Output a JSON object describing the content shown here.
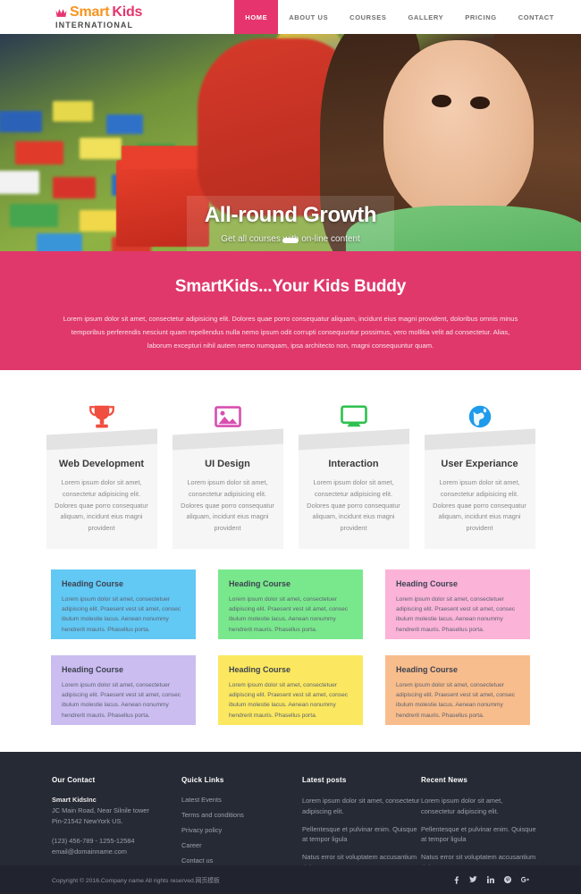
{
  "header": {
    "logo": {
      "icon": "crown-icon",
      "word1": "Smart",
      "word2": "Kids",
      "subtitle": "INTERNATIONAL",
      "color1": "#f7941e",
      "color2": "#e6356e"
    },
    "nav": [
      {
        "label": "HOME",
        "active": true
      },
      {
        "label": "ABOUT US",
        "active": false
      },
      {
        "label": "COURSES",
        "active": false
      },
      {
        "label": "GALLERY",
        "active": false
      },
      {
        "label": "PRICING",
        "active": false
      },
      {
        "label": "CONTACT",
        "active": false
      }
    ]
  },
  "hero": {
    "title": "All-round Growth",
    "subtitle": "Get all courses with on-line content",
    "slider_indicator": "slide-1-active"
  },
  "banner": {
    "title": "SmartKids...Your Kids Buddy",
    "text": "Lorem ipsum dolor sit amet, consectetur adipisicing elit. Dolores quae porro consequatur aliquam, incidunt eius magni provident, doloribus omnis minus temporibus perferendis nesciunt quam repellendus nulla nemo ipsum odit corrupti consequuntur possimus, vero mollitia velit ad consectetur. Alias, laborum excepturi nihil autem nemo numquam, ipsa architecto non, magni consequuntur quam.",
    "bg_color": "#e0386b"
  },
  "services": [
    {
      "icon": "trophy-icon",
      "icon_color": "#f04e3e",
      "title": "Web Development",
      "text": "Lorem ipsum dolor sit amet, consectetur adipisicing elit. Dolores quae porro consequatur aliquam, incidunt eius magni provident"
    },
    {
      "icon": "image-icon",
      "icon_color": "#d84fb0",
      "title": "UI Design",
      "text": "Lorem ipsum dolor sit amet, consectetur adipisicing elit. Dolores quae porro consequatur aliquam, incidunt eius magni provident"
    },
    {
      "icon": "monitor-icon",
      "icon_color": "#2fc14f",
      "title": "Interaction",
      "text": "Lorem ipsum dolor sit amet, consectetur adipisicing elit. Dolores quae porro consequatur aliquam, incidunt eius magni provident"
    },
    {
      "icon": "globe-icon",
      "icon_color": "#1e9bea",
      "title": "User Experiance",
      "text": "Lorem ipsum dolor sit amet, consectetur adipisicing elit. Dolores quae porro consequatur aliquam, incidunt eius magni provident"
    }
  ],
  "courses": [
    {
      "title": "Heading Course",
      "text": "Lorem ipsum dolor sit amet, consectetuer adipiscing elit. Praesent vest sit amet, consec ibulum molestie lacus. Aenean nonummy hendrerit mauris. Phasellus porta.",
      "color": "#62c8f4"
    },
    {
      "title": "Heading Course",
      "text": "Lorem ipsum dolor sit amet, consectetuer adipiscing elit. Praesent vest sit amet, consec ibulum molestie lacus. Aenean nonummy hendrerit mauris. Phasellus porta.",
      "color": "#79e88c"
    },
    {
      "title": "Heading Course",
      "text": "Lorem ipsum dolor sit amet, consectetuer adipiscing elit. Praesent vest sit amet, consec ibulum molestie lacus. Aenean nonummy hendrerit mauris. Phasellus porta.",
      "color": "#fbb3d8"
    },
    {
      "title": "Heading Course",
      "text": "Lorem ipsum dolor sit amet, consectetuer adipiscing elit. Praesent vest sit amet, consec ibulum molestie lacus. Aenean nonummy hendrerit mauris. Phasellus porta.",
      "color": "#cbbdf0"
    },
    {
      "title": "Heading Course",
      "text": "Lorem ipsum dolor sit amet, consectetuer adipiscing elit. Praesent vest sit amet, consec ibulum molestie lacus. Aenean nonummy hendrerit mauris. Phasellus porta.",
      "color": "#fbe860"
    },
    {
      "title": "Heading Course",
      "text": "Lorem ipsum dolor sit amet, consectetuer adipiscing elit. Praesent vest sit amet, consec ibulum molestie lacus. Aenean nonummy hendrerit mauris. Phasellus porta.",
      "color": "#f8bd8c"
    }
  ],
  "footer": {
    "contact": {
      "heading": "Our Contact",
      "company": "Smart KidsInc",
      "address_line1": "JC Main Road, Near Silnile tower",
      "address_line2": "Pin-21542 NewYork US.",
      "phone": "(123) 456-789 - 1255-12584",
      "email": "email@domainname.com"
    },
    "quick_links": {
      "heading": "Quick Links",
      "items": [
        "Latest Events",
        "Terms and conditions",
        "Privacy policy",
        "Career",
        "Contact us"
      ]
    },
    "latest_posts": {
      "heading": "Latest posts",
      "items": [
        "Lorem ipsum dolor sit amet, consectetur adipiscing elit.",
        "Pellentesque et pulvinar enim. Quisque at tempor ligula",
        "Natus error sit voluptatem accusantium doloremque"
      ]
    },
    "recent_news": {
      "heading": "Recent News",
      "items": [
        "Lorem ipsum dolor sit amet, consectetur adipiscing elit.",
        "Pellentesque et pulvinar enim. Quisque at tempor ligula",
        "Natus error sit voluptatem accusantium doloremque"
      ]
    },
    "copyright": "Copyright © 2016.Company name All rights reserved.网页模板",
    "socials": [
      "facebook-icon",
      "twitter-icon",
      "linkedin-icon",
      "pinterest-icon",
      "googleplus-icon"
    ]
  }
}
